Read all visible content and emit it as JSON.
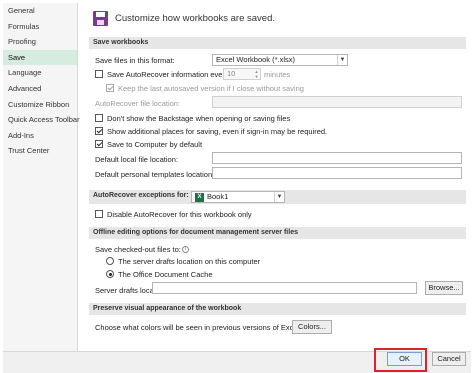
{
  "sidebar": {
    "items": [
      {
        "label": "General"
      },
      {
        "label": "Formulas"
      },
      {
        "label": "Proofing"
      },
      {
        "label": "Save"
      },
      {
        "label": "Language"
      },
      {
        "label": "Advanced"
      },
      {
        "label": "Customize Ribbon"
      },
      {
        "label": "Quick Access Toolbar"
      },
      {
        "label": "Add-Ins"
      },
      {
        "label": "Trust Center"
      }
    ],
    "active": "Save"
  },
  "header": {
    "icon": "floppy-disk-icon",
    "title": "Customize how workbooks are saved."
  },
  "save_workbooks": {
    "section_title": "Save workbooks",
    "format_label": "Save files in this format:",
    "format_value": "Excel Workbook (*.xlsx)",
    "autorecover_label": "Save AutoRecover information every",
    "autorecover_checked": false,
    "autorecover_minutes": "10",
    "minutes_label": "minutes",
    "keep_last_label": "Keep the last autosaved version if I close without saving",
    "keep_last_checked": true,
    "autorecover_location_label": "AutoRecover file location:",
    "autorecover_location_value": "",
    "backstage_label": "Don't show the Backstage when opening or saving files",
    "backstage_checked": false,
    "additional_places_label": "Show additional places for saving, even if sign-in may be required.",
    "additional_places_checked": true,
    "save_computer_label": "Save to Computer by default",
    "save_computer_checked": true,
    "default_local_label": "Default local file location:",
    "default_local_value": "",
    "default_templates_label": "Default personal templates location:",
    "default_templates_value": ""
  },
  "autorecover_exceptions": {
    "label": "AutoRecover exceptions for:",
    "workbook": "Book1",
    "disable_label": "Disable AutoRecover for this workbook only",
    "disable_checked": false
  },
  "offline_editing": {
    "section_title": "Offline editing options for document management server files",
    "save_checked_out_label": "Save checked-out files to:",
    "option_server": "The server drafts location on this computer",
    "option_cache": "The Office Document Cache",
    "selected": "cache",
    "server_drafts_label": "Server drafts location:",
    "server_drafts_value": "",
    "browse_label": "Browse..."
  },
  "visual_appearance": {
    "section_title": "Preserve visual appearance of the workbook",
    "colors_label": "Choose what colors will be seen in previous versions of Excel:",
    "colors_button": "Colors..."
  },
  "footer": {
    "ok_label": "OK",
    "cancel_label": "Cancel"
  },
  "colors": {
    "active_nav": "#d6ecde",
    "highlight": "#d9252a",
    "excel_green": "#1e7145"
  }
}
